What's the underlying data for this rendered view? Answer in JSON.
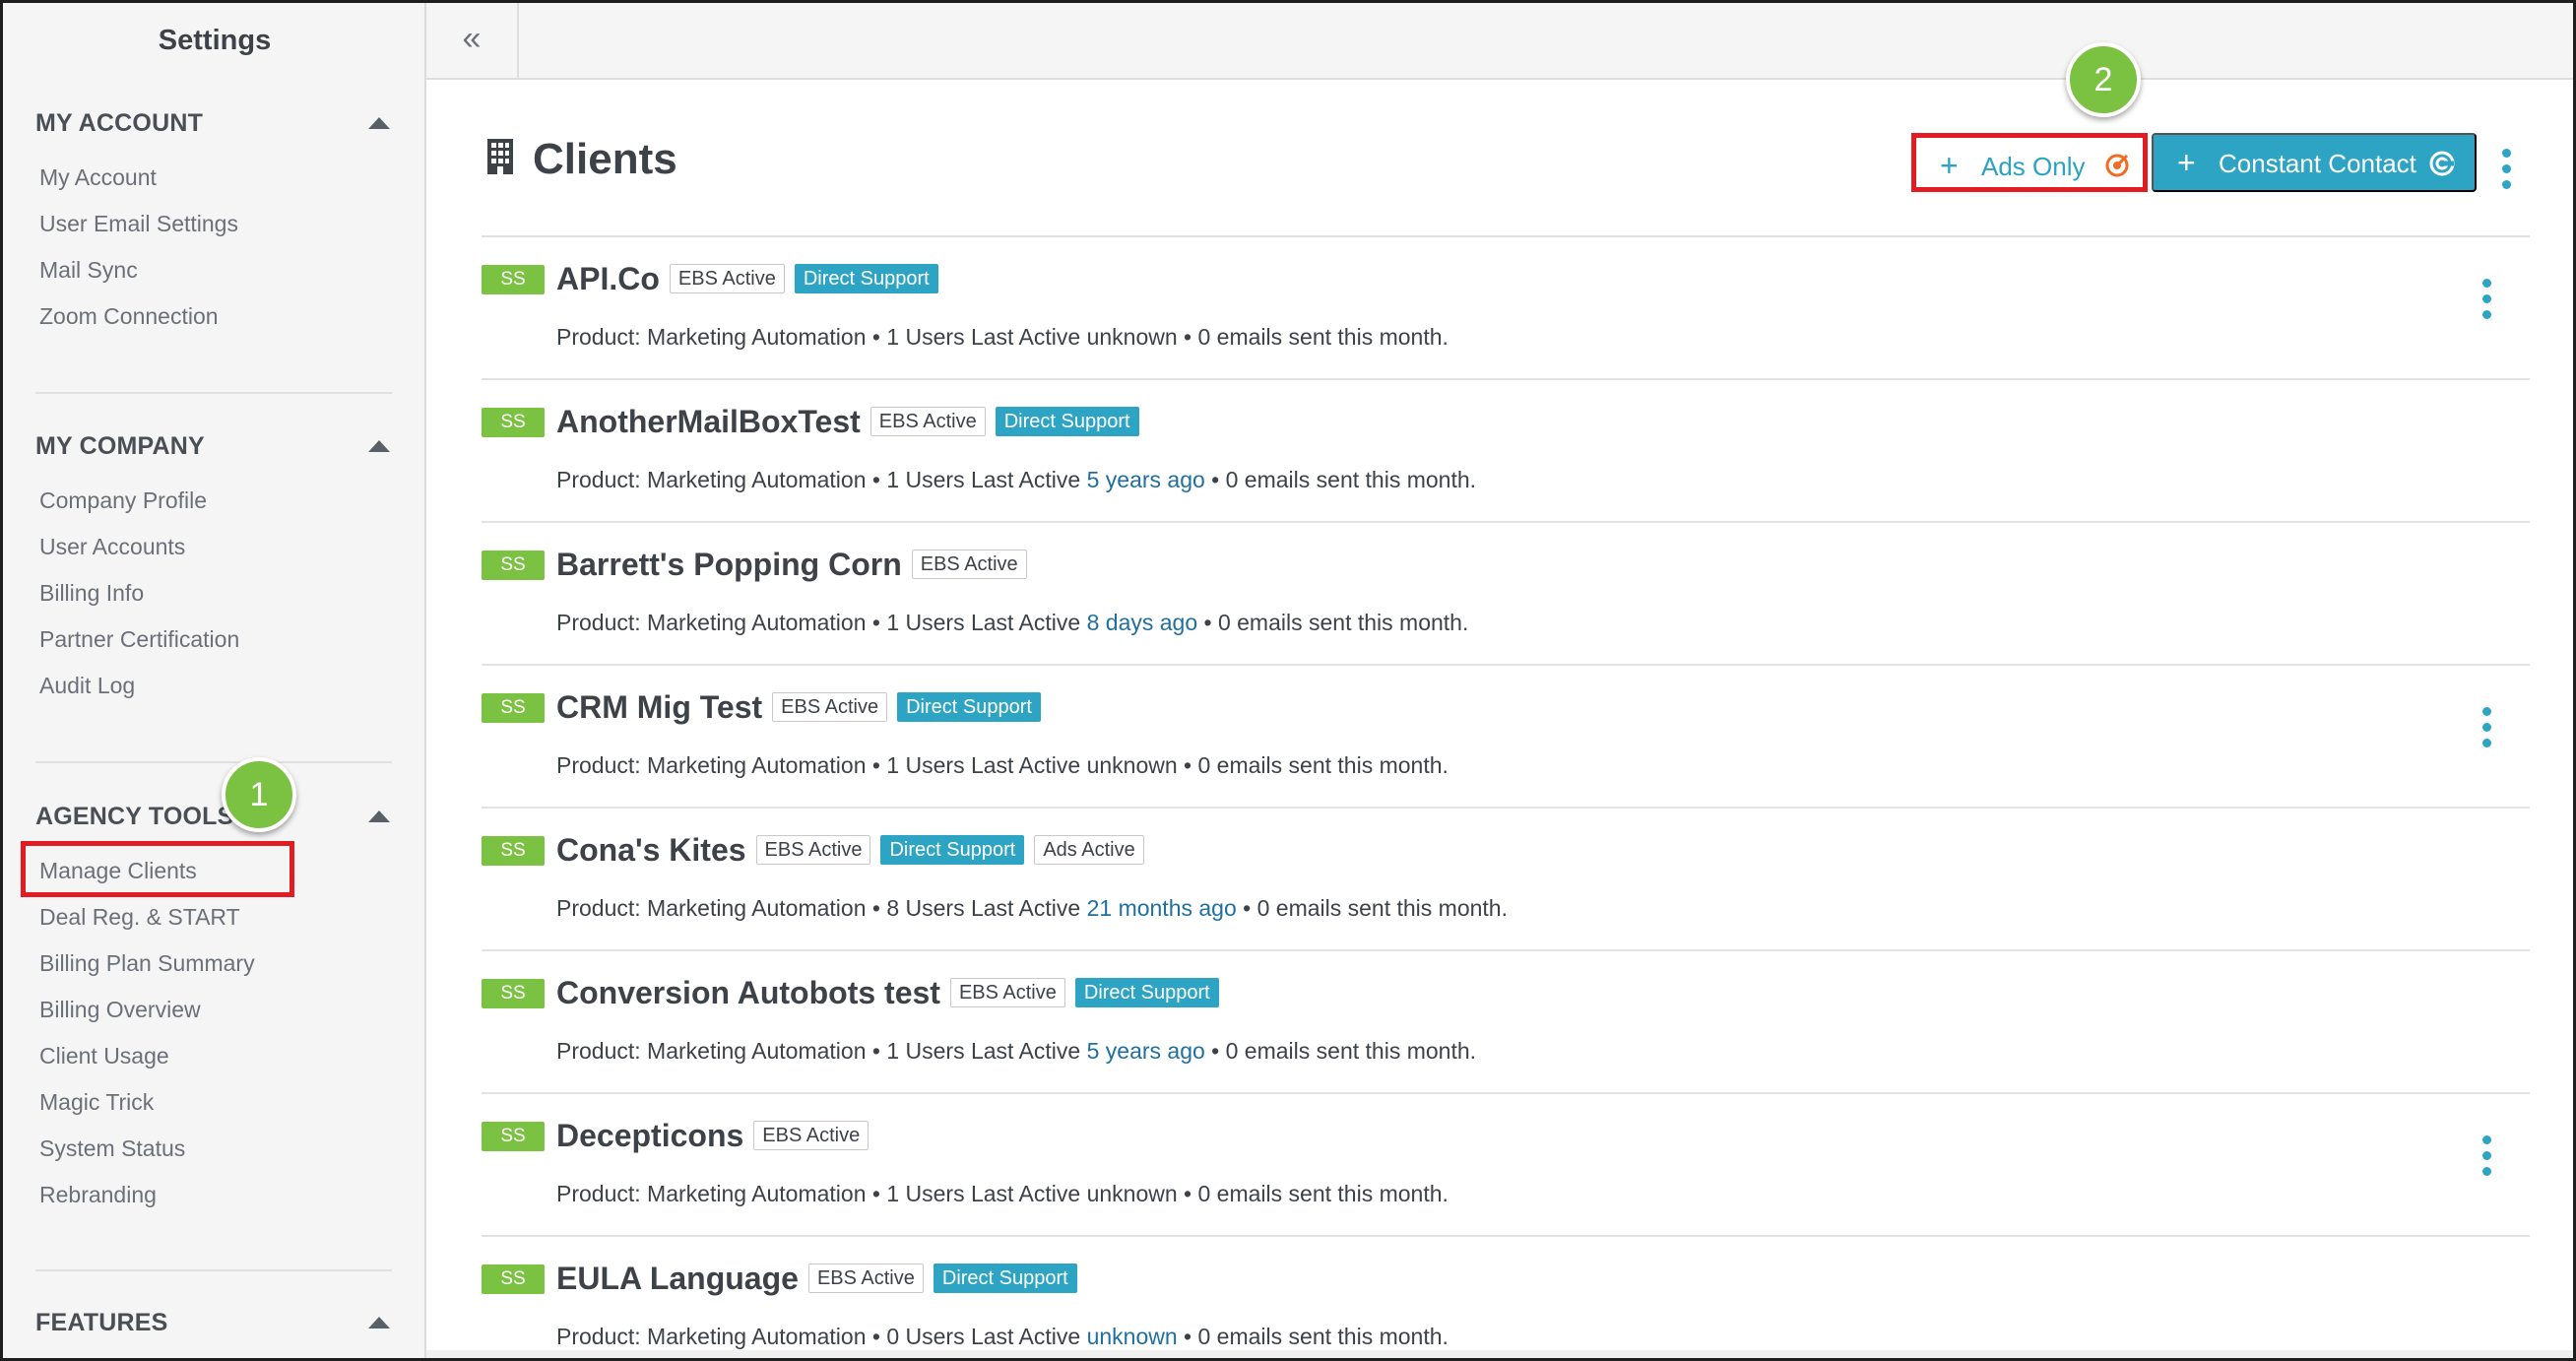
{
  "sidebar": {
    "title": "Settings",
    "sections": [
      {
        "header": "MY ACCOUNT",
        "items": [
          "My Account",
          "User Email Settings",
          "Mail Sync",
          "Zoom Connection"
        ]
      },
      {
        "header": "MY COMPANY",
        "items": [
          "Company Profile",
          "User Accounts",
          "Billing Info",
          "Partner Certification",
          "Audit Log"
        ]
      },
      {
        "header": "AGENCY TOOLS",
        "items": [
          "Manage Clients",
          "Deal Reg. & START",
          "Billing Plan Summary",
          "Billing Overview",
          "Client Usage",
          "Magic Trick",
          "System Status",
          "Rebranding"
        ]
      },
      {
        "header": "FEATURES",
        "items": []
      }
    ]
  },
  "callouts": {
    "step1": "1",
    "step2": "2"
  },
  "topbar": {
    "collapse_glyph": "«"
  },
  "page": {
    "title": "Clients",
    "ads_only_label": "Ads Only",
    "constant_contact_label": "Constant Contact",
    "plus_glyph": "+",
    "accent_color": "#2ea4c4",
    "highlight_color": "#e31b23",
    "badge_color": "#7bc142"
  },
  "clients": [
    {
      "tag": "SS",
      "name": "API.Co",
      "badges": [
        "EBS Active",
        "Direct Support"
      ],
      "product": "Product: Marketing Automation • 1 Users Last Active ",
      "last_active": "unknown",
      "last_active_link": false,
      "emails": " • 0 emails sent this month.",
      "kebab": true
    },
    {
      "tag": "SS",
      "name": "AnotherMailBoxTest",
      "badges": [
        "EBS Active",
        "Direct Support"
      ],
      "product": "Product: Marketing Automation • 1 Users Last Active ",
      "last_active": "5 years ago",
      "last_active_link": true,
      "emails": " • 0 emails sent this month.",
      "kebab": false
    },
    {
      "tag": "SS",
      "name": "Barrett's Popping Corn",
      "badges": [
        "EBS Active"
      ],
      "product": "Product: Marketing Automation • 1 Users Last Active ",
      "last_active": "8 days ago",
      "last_active_link": true,
      "emails": " • 0 emails sent this month.",
      "kebab": false
    },
    {
      "tag": "SS",
      "name": "CRM Mig Test",
      "badges": [
        "EBS Active",
        "Direct Support"
      ],
      "product": "Product: Marketing Automation • 1 Users Last Active ",
      "last_active": "unknown",
      "last_active_link": false,
      "emails": " • 0 emails sent this month.",
      "kebab": true
    },
    {
      "tag": "SS",
      "name": "Cona's Kites",
      "badges": [
        "EBS Active",
        "Direct Support",
        "Ads Active"
      ],
      "product": "Product: Marketing Automation • 8 Users Last Active ",
      "last_active": "21 months ago",
      "last_active_link": true,
      "emails": " • 0 emails sent this month.",
      "kebab": false
    },
    {
      "tag": "SS",
      "name": "Conversion Autobots test",
      "badges": [
        "EBS Active",
        "Direct Support"
      ],
      "product": "Product: Marketing Automation • 1 Users Last Active ",
      "last_active": "5 years ago",
      "last_active_link": true,
      "emails": " • 0 emails sent this month.",
      "kebab": false
    },
    {
      "tag": "SS",
      "name": "Decepticons",
      "badges": [
        "EBS Active"
      ],
      "product": "Product: Marketing Automation • 1 Users Last Active ",
      "last_active": "unknown",
      "last_active_link": false,
      "emails": " • 0 emails sent this month.",
      "kebab": true
    },
    {
      "tag": "SS",
      "name": "EULA Language",
      "badges": [
        "EBS Active",
        "Direct Support"
      ],
      "product": "Product: Marketing Automation • 0 Users Last Active ",
      "last_active": "unknown",
      "last_active_link": true,
      "emails": " • 0 emails sent this month.",
      "kebab": false
    }
  ]
}
